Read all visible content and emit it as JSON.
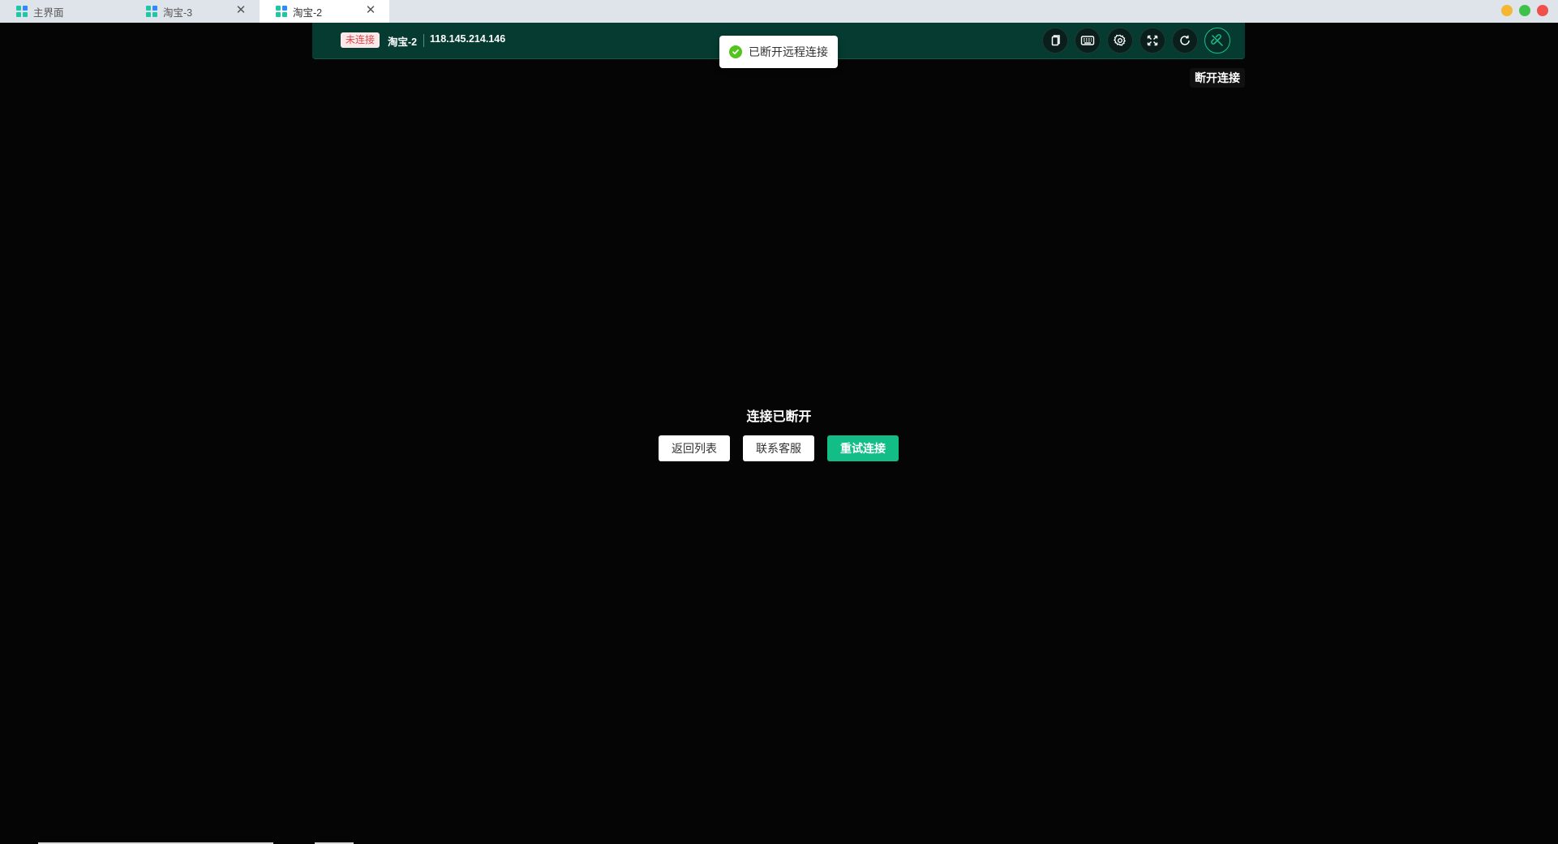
{
  "tabs": [
    {
      "label": "主界面",
      "active": false,
      "closable": false
    },
    {
      "label": "淘宝-3",
      "active": false,
      "closable": true
    },
    {
      "label": "淘宝-2",
      "active": true,
      "closable": true
    }
  ],
  "tab_close_glyph": "✕",
  "window_controls": {
    "minimize_color": "#f5b731",
    "maximize_color": "#3cc24a",
    "close_color": "#f0504b"
  },
  "remote_toolbar": {
    "status_badge": "未连接",
    "device_name": "淘宝-2",
    "device_ip": "118.145.214.146",
    "buttons": [
      {
        "name": "copy-icon"
      },
      {
        "name": "keyboard-icon"
      },
      {
        "name": "gear-icon"
      },
      {
        "name": "fullscreen-icon"
      },
      {
        "name": "refresh-icon"
      },
      {
        "name": "disconnect-icon",
        "active": true
      }
    ]
  },
  "toast": {
    "message": "已断开远程连接",
    "icon": "check-circle-icon"
  },
  "tooltip": {
    "text": "断开连接"
  },
  "disconnected_panel": {
    "title": "连接已断开",
    "back_label": "返回列表",
    "support_label": "联系客服",
    "retry_label": "重试连接"
  },
  "colors": {
    "accent": "#13be86",
    "toolbar_bg": "#053b30",
    "background": "#050505",
    "error": "#e2454a",
    "success": "#52c41a"
  }
}
